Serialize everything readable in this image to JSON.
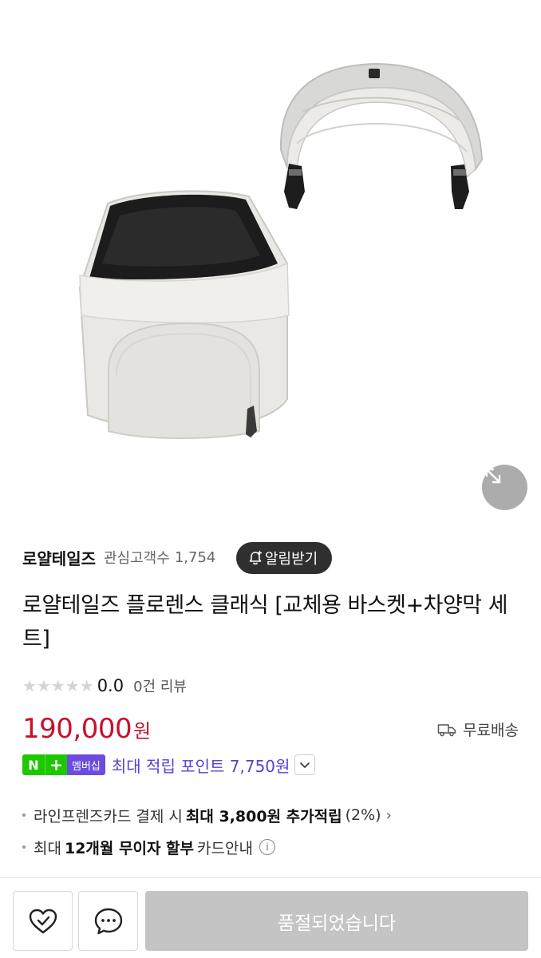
{
  "store": {
    "name": "로얄테일즈",
    "follower_label": "관심고객수",
    "follower_count": "1,754",
    "alert_button": "알림받기"
  },
  "product": {
    "title": "로얄테일즈 플로렌스 클래식 [교체용 바스켓+차양막 세트]",
    "rating": "0.0",
    "review_count": "0건 리뷰",
    "stars_filled": 0,
    "stars_total": 5,
    "price": "190,000",
    "price_unit": "원",
    "shipping": "무료배송"
  },
  "membership": {
    "badge_n": "N",
    "badge_plus": "+",
    "badge_label": "멤버십",
    "point_text": "최대 적립 포인트 7,750원"
  },
  "benefits": {
    "card_prefix": "라인프렌즈카드 결제 시",
    "card_bold": "최대 3,800원 추가적립",
    "card_suffix": "(2%)",
    "installment_prefix": "최대",
    "installment_bold": "12개월 무이자 할부",
    "installment_suffix": "카드안내",
    "info_glyph": "i"
  },
  "bottom_bar": {
    "soldout_label": "품절되었습니다"
  },
  "icons": {
    "expand": "expand-icon",
    "bell": "bell-plus-icon",
    "truck": "truck-icon",
    "heart": "heart-check-icon",
    "chat": "chat-bubble-icon"
  },
  "colors": {
    "price": "#c8102e",
    "point": "#5a3fd2",
    "naver_green": "#1ec800",
    "member_purple": "#6b4cde",
    "soldout_bg": "#c4c4c4"
  }
}
